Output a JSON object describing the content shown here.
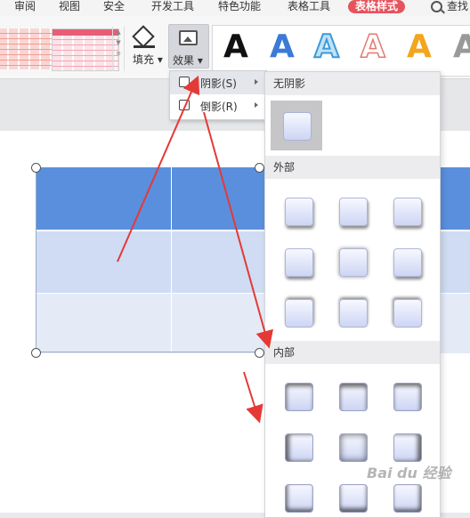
{
  "menubar": {
    "items": [
      "审阅",
      "视图",
      "安全",
      "开发工具",
      "特色功能",
      "表格工具"
    ],
    "active_tab": "表格样式",
    "search_label": "查找"
  },
  "ribbon": {
    "fill_label": "填充",
    "effect_label": "效果",
    "wordart_letters": [
      "A",
      "A",
      "A",
      "A",
      "A",
      "A"
    ]
  },
  "effect_menu": {
    "shadow_label": "阴影(S)",
    "reflection_label": "倒影(R)"
  },
  "shadow_submenu": {
    "no_shadow_label": "无阴影",
    "outer_label": "外部",
    "inner_label": "内部"
  },
  "watermark": "Bai du 经验",
  "colors": {
    "accent": "#e5545d",
    "table_header": "#5a8fde",
    "annotation_arrow": "#e53935"
  }
}
